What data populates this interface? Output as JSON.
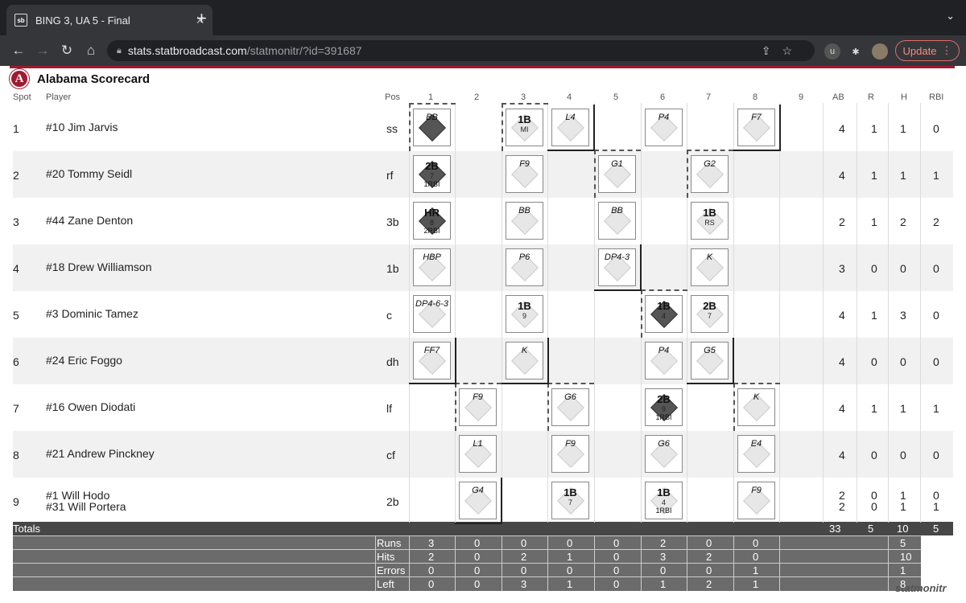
{
  "browser": {
    "tab_title": "BING 3, UA 5 - Final",
    "favicon_text": "sb",
    "url_host": "stats.statbroadcast.com",
    "url_path": "/statmonitr/?id=391687",
    "update_label": "Update"
  },
  "page": {
    "title": "Alabama Scorecard",
    "logo_letter": "A",
    "headers": {
      "spot": "Spot",
      "player": "Player",
      "pos": "Pos",
      "ab": "AB",
      "r": "R",
      "h": "H",
      "rbi": "RBI"
    },
    "innings": [
      "1",
      "2",
      "3",
      "4",
      "5",
      "6",
      "7",
      "8",
      "9"
    ]
  },
  "rows": [
    {
      "spot": "1",
      "players": [
        "#10 Jim Jarvis"
      ],
      "pos": "ss",
      "ab": [
        "4"
      ],
      "r": [
        "1"
      ],
      "h": [
        "1"
      ],
      "rbi": [
        "0"
      ]
    },
    {
      "spot": "2",
      "players": [
        "#20 Tommy Seidl"
      ],
      "pos": "rf",
      "ab": [
        "4"
      ],
      "r": [
        "1"
      ],
      "h": [
        "1"
      ],
      "rbi": [
        "1"
      ]
    },
    {
      "spot": "3",
      "players": [
        "#44 Zane Denton"
      ],
      "pos": "3b",
      "ab": [
        "2"
      ],
      "r": [
        "1"
      ],
      "h": [
        "2"
      ],
      "rbi": [
        "2"
      ]
    },
    {
      "spot": "4",
      "players": [
        "#18 Drew Williamson"
      ],
      "pos": "1b",
      "ab": [
        "3"
      ],
      "r": [
        "0"
      ],
      "h": [
        "0"
      ],
      "rbi": [
        "0"
      ]
    },
    {
      "spot": "5",
      "players": [
        "#3 Dominic Tamez"
      ],
      "pos": "c",
      "ab": [
        "4"
      ],
      "r": [
        "1"
      ],
      "h": [
        "3"
      ],
      "rbi": [
        "0"
      ]
    },
    {
      "spot": "6",
      "players": [
        "#24 Eric Foggo"
      ],
      "pos": "dh",
      "ab": [
        "4"
      ],
      "r": [
        "0"
      ],
      "h": [
        "0"
      ],
      "rbi": [
        "0"
      ]
    },
    {
      "spot": "7",
      "players": [
        "#16 Owen Diodati"
      ],
      "pos": "lf",
      "ab": [
        "4"
      ],
      "r": [
        "1"
      ],
      "h": [
        "1"
      ],
      "rbi": [
        "1"
      ]
    },
    {
      "spot": "8",
      "players": [
        "#21 Andrew Pinckney"
      ],
      "pos": "cf",
      "ab": [
        "4"
      ],
      "r": [
        "0"
      ],
      "h": [
        "0"
      ],
      "rbi": [
        "0"
      ]
    },
    {
      "spot": "9",
      "players": [
        "#1 Will Hodo",
        "#31 Will Portera"
      ],
      "pos": "2b",
      "ab": [
        "2",
        "2"
      ],
      "r": [
        "0",
        "0"
      ],
      "h": [
        "1",
        "1"
      ],
      "rbi": [
        "0",
        "1"
      ]
    }
  ],
  "plays": [
    {
      "row": 1,
      "inn": 1,
      "label": "BB",
      "big": false,
      "sub": "",
      "sub2": "",
      "full": true
    },
    {
      "row": 1,
      "inn": 3,
      "label": "1B",
      "big": true,
      "sub": "MI",
      "sub2": "",
      "full": false
    },
    {
      "row": 1,
      "inn": 4,
      "label": "L4",
      "big": false,
      "sub": "",
      "sub2": "",
      "full": false
    },
    {
      "row": 1,
      "inn": 6,
      "label": "P4",
      "big": false,
      "sub": "",
      "sub2": "",
      "full": false
    },
    {
      "row": 1,
      "inn": 8,
      "label": "F7",
      "big": false,
      "sub": "",
      "sub2": "",
      "full": false
    },
    {
      "row": 2,
      "inn": 1,
      "label": "2B",
      "big": true,
      "sub": "7",
      "sub2": "1RBI",
      "full": true
    },
    {
      "row": 2,
      "inn": 3,
      "label": "F9",
      "big": false,
      "sub": "",
      "sub2": "",
      "full": false
    },
    {
      "row": 2,
      "inn": 5,
      "label": "G1",
      "big": false,
      "sub": "",
      "sub2": "",
      "full": false
    },
    {
      "row": 2,
      "inn": 7,
      "label": "G2",
      "big": false,
      "sub": "",
      "sub2": "",
      "full": false
    },
    {
      "row": 3,
      "inn": 1,
      "label": "HR",
      "big": true,
      "sub": "8",
      "sub2": "2RBI",
      "full": true
    },
    {
      "row": 3,
      "inn": 3,
      "label": "BB",
      "big": false,
      "sub": "",
      "sub2": "",
      "full": false
    },
    {
      "row": 3,
      "inn": 5,
      "label": "BB",
      "big": false,
      "sub": "",
      "sub2": "",
      "full": false
    },
    {
      "row": 3,
      "inn": 7,
      "label": "1B",
      "big": true,
      "sub": "RS",
      "sub2": "",
      "full": false
    },
    {
      "row": 4,
      "inn": 1,
      "label": "HBP",
      "big": false,
      "sub": "",
      "sub2": "",
      "full": false
    },
    {
      "row": 4,
      "inn": 3,
      "label": "P6",
      "big": false,
      "sub": "",
      "sub2": "",
      "full": false
    },
    {
      "row": 4,
      "inn": 5,
      "label": "DP4-3",
      "big": false,
      "sub": "",
      "sub2": "",
      "full": false
    },
    {
      "row": 4,
      "inn": 7,
      "label": "K",
      "big": false,
      "sub": "",
      "sub2": "",
      "full": false
    },
    {
      "row": 5,
      "inn": 1,
      "label": "DP4-6-3",
      "big": false,
      "sub": "",
      "sub2": "",
      "full": false
    },
    {
      "row": 5,
      "inn": 3,
      "label": "1B",
      "big": true,
      "sub": "9",
      "sub2": "",
      "full": false
    },
    {
      "row": 5,
      "inn": 6,
      "label": "1B",
      "big": true,
      "sub": "4",
      "sub2": "",
      "full": true
    },
    {
      "row": 5,
      "inn": 7,
      "label": "2B",
      "big": true,
      "sub": "7",
      "sub2": "",
      "full": false
    },
    {
      "row": 6,
      "inn": 1,
      "label": "FF7",
      "big": false,
      "sub": "",
      "sub2": "",
      "full": false
    },
    {
      "row": 6,
      "inn": 3,
      "label": "K",
      "big": false,
      "sub": "",
      "sub2": "",
      "full": false
    },
    {
      "row": 6,
      "inn": 6,
      "label": "P4",
      "big": false,
      "sub": "",
      "sub2": "",
      "full": false
    },
    {
      "row": 6,
      "inn": 7,
      "label": "G5",
      "big": false,
      "sub": "",
      "sub2": "",
      "full": false
    },
    {
      "row": 7,
      "inn": 2,
      "label": "F9",
      "big": false,
      "sub": "",
      "sub2": "",
      "full": false
    },
    {
      "row": 7,
      "inn": 4,
      "label": "G6",
      "big": false,
      "sub": "",
      "sub2": "",
      "full": false
    },
    {
      "row": 7,
      "inn": 6,
      "label": "2B",
      "big": true,
      "sub": "9",
      "sub2": "1RBI",
      "full": true
    },
    {
      "row": 7,
      "inn": 8,
      "label": "K",
      "big": false,
      "sub": "",
      "sub2": "",
      "full": false
    },
    {
      "row": 8,
      "inn": 2,
      "label": "L1",
      "big": false,
      "sub": "",
      "sub2": "",
      "full": false
    },
    {
      "row": 8,
      "inn": 4,
      "label": "F9",
      "big": false,
      "sub": "",
      "sub2": "",
      "full": false
    },
    {
      "row": 8,
      "inn": 6,
      "label": "G6",
      "big": false,
      "sub": "",
      "sub2": "",
      "full": false
    },
    {
      "row": 8,
      "inn": 8,
      "label": "E4",
      "big": false,
      "sub": "",
      "sub2": "",
      "full": false
    },
    {
      "row": 9,
      "inn": 2,
      "label": "G4",
      "big": false,
      "sub": "",
      "sub2": "",
      "full": false
    },
    {
      "row": 9,
      "inn": 4,
      "label": "1B",
      "big": true,
      "sub": "7",
      "sub2": "",
      "full": false
    },
    {
      "row": 9,
      "inn": 6,
      "label": "1B",
      "big": true,
      "sub": "4",
      "sub2": "1RBI",
      "full": false
    },
    {
      "row": 9,
      "inn": 8,
      "label": "F9",
      "big": false,
      "sub": "",
      "sub2": "",
      "full": false
    }
  ],
  "totals": {
    "label": "Totals",
    "ab": "33",
    "r": "5",
    "h": "10",
    "rbi": "5"
  },
  "linescore": [
    {
      "label": "Runs",
      "values": [
        "3",
        "0",
        "0",
        "0",
        "0",
        "2",
        "0",
        "0"
      ],
      "total": "5"
    },
    {
      "label": "Hits",
      "values": [
        "2",
        "0",
        "2",
        "1",
        "0",
        "3",
        "2",
        "0"
      ],
      "total": "10"
    },
    {
      "label": "Errors",
      "values": [
        "0",
        "0",
        "0",
        "0",
        "0",
        "0",
        "0",
        "1"
      ],
      "total": "1"
    },
    {
      "label": "Left",
      "values": [
        "0",
        "0",
        "3",
        "1",
        "0",
        "1",
        "2",
        "1"
      ],
      "total": "8"
    }
  ],
  "watermark": "statmonitr"
}
